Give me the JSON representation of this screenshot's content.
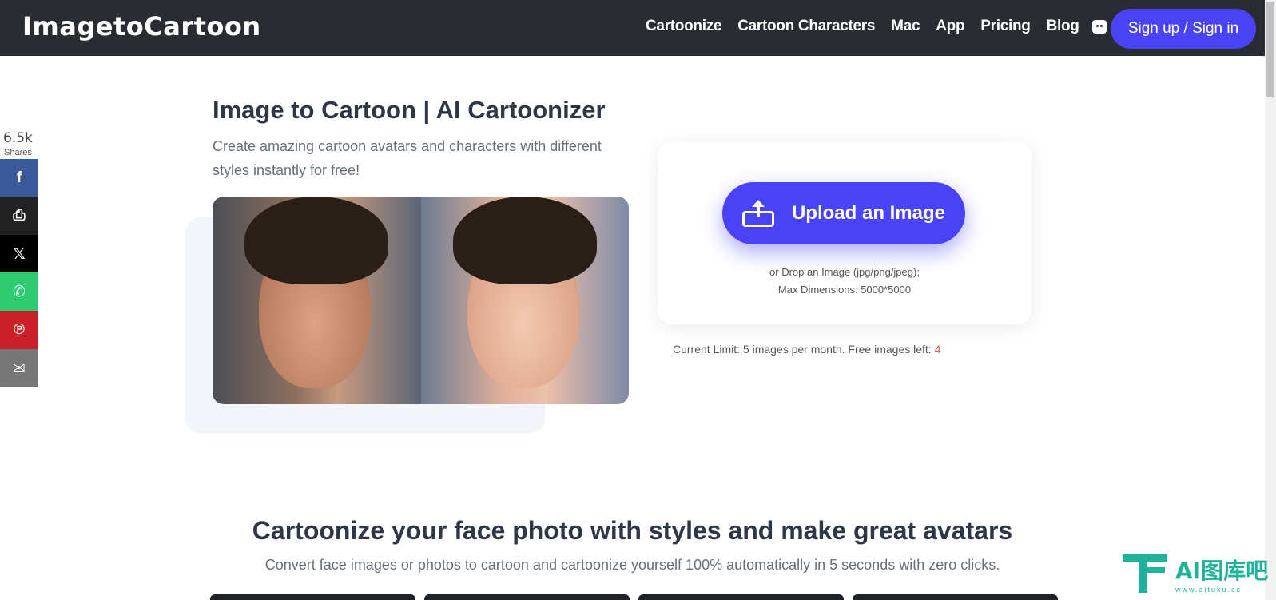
{
  "header": {
    "brand": "ImagetoCartoon",
    "nav": [
      "Cartoonize",
      "Cartoon Characters",
      "Mac",
      "App",
      "Pricing",
      "Blog"
    ],
    "signin_label": "Sign up / Sign in"
  },
  "share": {
    "count": "6.5k",
    "label": "Shares",
    "buttons": [
      {
        "name": "facebook",
        "glyph": "f"
      },
      {
        "name": "print",
        "glyph": "⎙"
      },
      {
        "name": "x",
        "glyph": "𝕏"
      },
      {
        "name": "whatsapp",
        "glyph": "✆"
      },
      {
        "name": "pinterest",
        "glyph": "℗"
      },
      {
        "name": "email",
        "glyph": "✉"
      }
    ]
  },
  "hero": {
    "title": "Image to Cartoon | AI Cartoonizer",
    "subtitle": "Create amazing cartoon avatars and characters with different styles instantly for free!"
  },
  "upload": {
    "button_label": "Upload an Image",
    "hint_line1": "or Drop an Image (jpg/png/jpeg);",
    "hint_line2": "Max Dimensions: 5000*5000",
    "limit_text": "Current Limit: 5 images per month. Free images left: ",
    "limit_remaining": "4"
  },
  "section": {
    "title": "Cartoonize your face photo with styles and make great avatars",
    "subtitle": "Convert face images or photos to cartoon and cartoonize yourself 100% automatically in 5 seconds with zero clicks."
  },
  "watermark": {
    "main": "AI图库吧",
    "url": "www.aituku.cc"
  },
  "colors": {
    "nav_bg": "#292c33",
    "accent": "#4a42f5",
    "limit_highlight": "#e05757",
    "watermark": "#1fb39b"
  }
}
